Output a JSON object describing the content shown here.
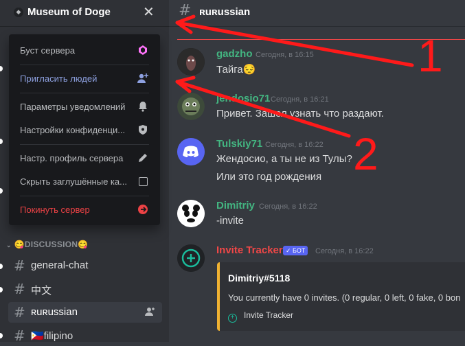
{
  "server": {
    "name": "Museum of Doge",
    "close_glyph": "✕"
  },
  "menu": {
    "items": [
      {
        "label": "Буст сервера",
        "icon": "boost-gem-icon",
        "color": "#b9bbbe"
      },
      {
        "label": "Пригласить людей",
        "icon": "add-person-icon",
        "color": "#8ea1e1"
      },
      {
        "label": "Параметры уведомлений",
        "icon": "bell-icon",
        "color": "#b9bbbe"
      },
      {
        "label": "Настройки конфиденци...",
        "icon": "shield-icon",
        "color": "#b9bbbe"
      },
      {
        "label": "Настр. профиль сервера",
        "icon": "pencil-icon",
        "color": "#b9bbbe"
      },
      {
        "label": "Скрыть заглушённые ка...",
        "icon": "checkbox-icon",
        "color": "#b9bbbe"
      },
      {
        "label": "Покинуть сервер",
        "icon": "leave-icon",
        "color": "#ed4245"
      }
    ]
  },
  "channels": {
    "category": "😋DISCUSSION😋",
    "list": [
      {
        "name": "general-chat"
      },
      {
        "name": "中文"
      },
      {
        "name": "ʀuʀussian"
      },
      {
        "name": "🇵🇭filipino"
      }
    ]
  },
  "topbar": {
    "channel": "ʀuʀussian"
  },
  "messages": [
    {
      "author": "gadzho",
      "author_color": "#43b581",
      "time": "Сегодня, в 16:15",
      "lines": [
        "Тайга😔"
      ]
    },
    {
      "author": "jendosio71",
      "author_color": "#43b581",
      "time": "Сегодня, в 16:21",
      "lines": [
        "Привет. Зашел узнать что раздают."
      ]
    },
    {
      "author": "Tulskiy71",
      "author_color": "#43b581",
      "time": "Сегодня, в 16:22",
      "lines": [
        "Жендосио, а ты не из Тулы?",
        "Или это год рождения"
      ]
    },
    {
      "author": "Dimitriy",
      "author_color": "#43b581",
      "time": "Сегодня, в 16:22",
      "lines": [
        "-invite"
      ]
    },
    {
      "author": "Invite Tracker",
      "author_color": "#f04747",
      "bot_tag": "✓ БОТ",
      "time": "Сегодня, в 16:22"
    }
  ],
  "embed": {
    "title": "Dimitriy#5118",
    "description": "You currently have 0 invites. (0 regular, 0 left, 0 fake, 0 bon",
    "footer": "Invite Tracker"
  },
  "annotations": {
    "arrow1_label": "1",
    "arrow2_label": "2",
    "arrow_color": "#ff0000"
  }
}
